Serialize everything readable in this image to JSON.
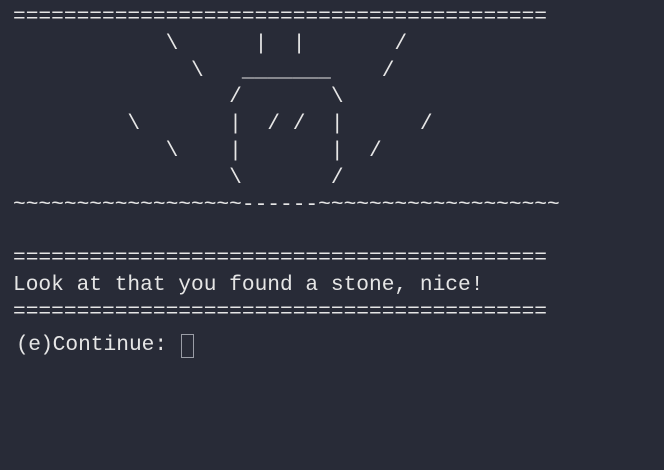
{
  "terminal": {
    "art_lines": [
      "==========================================",
      "            \\      |  |       /",
      "              \\   _______    /",
      "                 /       \\",
      "         \\       |  / /  |      /",
      "            \\    |       |  /",
      "                 \\       /",
      "~~~~~~~~~~~~~~~~~~------~~~~~~~~~~~~~~~~~~~",
      "",
      "==========================================",
      "Look at that you found a stone, nice!",
      "=========================================="
    ],
    "prompt_key": "(e)",
    "prompt_label": "Continue: ",
    "input_value": ""
  },
  "colors": {
    "background": "#282b37",
    "text": "#e6e6e6",
    "cursor_border": "#9a9da6"
  }
}
